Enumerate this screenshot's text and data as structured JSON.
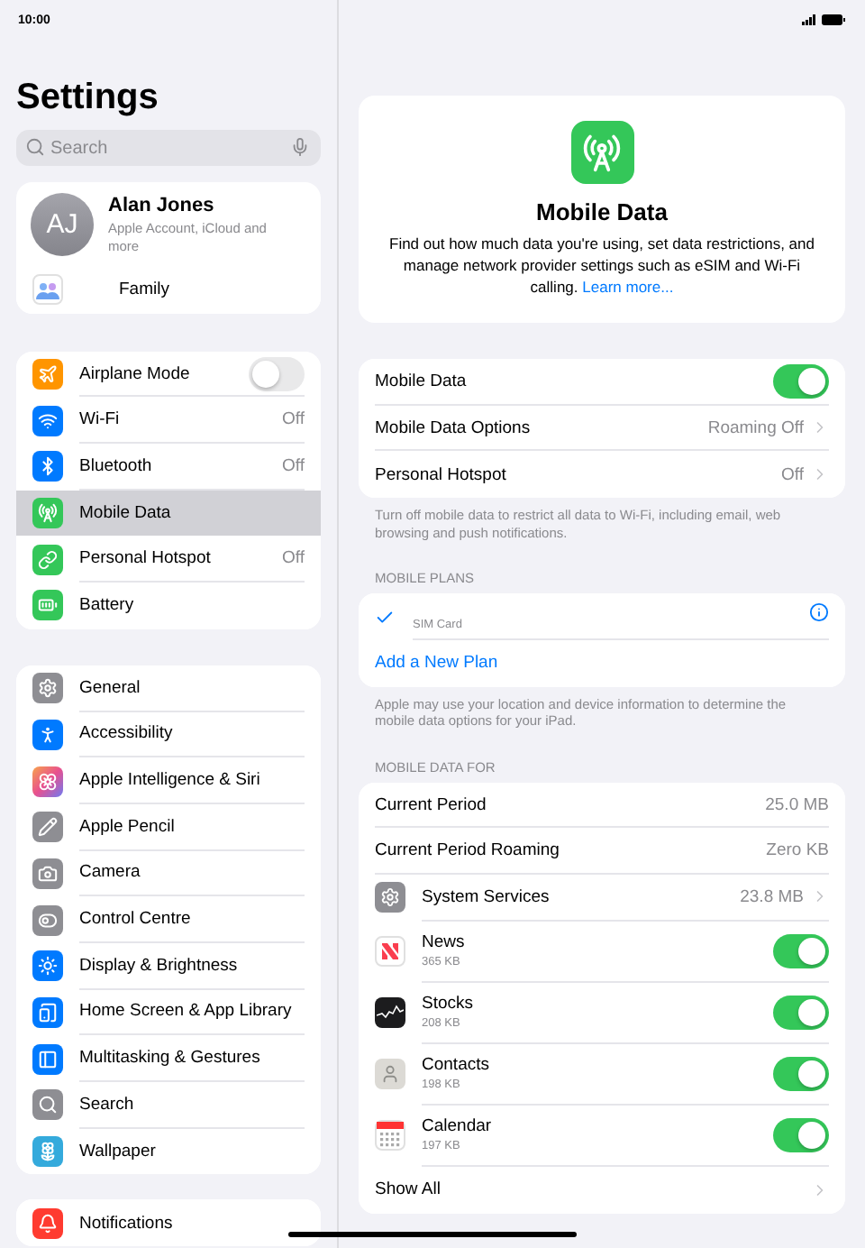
{
  "status_bar": {
    "time": "10:00"
  },
  "sidebar": {
    "title": "Settings",
    "search": {
      "placeholder": "Search"
    },
    "account": {
      "initials": "AJ",
      "name": "Alan Jones",
      "subtitle": "Apple Account, iCloud and more",
      "family": "Family"
    },
    "groups": [
      [
        {
          "label": "Airplane Mode",
          "kind": "toggle",
          "on": false,
          "selected": false
        },
        {
          "label": "Wi-Fi",
          "kind": "value",
          "value": "Off",
          "selected": false
        },
        {
          "label": "Bluetooth",
          "kind": "value",
          "value": "Off",
          "selected": false
        },
        {
          "label": "Mobile Data",
          "kind": "plain",
          "selected": true
        },
        {
          "label": "Personal Hotspot",
          "kind": "value",
          "value": "Off",
          "selected": false
        },
        {
          "label": "Battery",
          "kind": "plain",
          "selected": false
        }
      ],
      [
        {
          "label": "General",
          "kind": "plain",
          "selected": false
        },
        {
          "label": "Accessibility",
          "kind": "plain",
          "selected": false
        },
        {
          "label": "Apple Intelligence & Siri",
          "kind": "plain",
          "selected": false
        },
        {
          "label": "Apple Pencil",
          "kind": "plain",
          "selected": false
        },
        {
          "label": "Camera",
          "kind": "plain",
          "selected": false
        },
        {
          "label": "Control Centre",
          "kind": "plain",
          "selected": false
        },
        {
          "label": "Display & Brightness",
          "kind": "plain",
          "selected": false
        },
        {
          "label": "Home Screen & App Library",
          "kind": "plain",
          "selected": false
        },
        {
          "label": "Multitasking & Gestures",
          "kind": "plain",
          "selected": false
        },
        {
          "label": "Search",
          "kind": "plain",
          "selected": false
        },
        {
          "label": "Wallpaper",
          "kind": "plain",
          "selected": false
        }
      ],
      [
        {
          "label": "Notifications",
          "kind": "plain",
          "selected": false
        }
      ]
    ]
  },
  "detail": {
    "header": {
      "title": "Mobile Data",
      "description": "Find out how much data you're using, set data restrictions, and manage network provider settings such as eSIM and Wi-Fi calling.",
      "link": "Learn more..."
    },
    "settings": [
      {
        "label": "Mobile Data",
        "kind": "toggle",
        "on": true
      },
      {
        "label": "Mobile Data Options",
        "kind": "link",
        "value": "Roaming Off"
      },
      {
        "label": "Personal Hotspot",
        "kind": "link",
        "value": "Off"
      }
    ],
    "settings_note": "Turn off mobile data to restrict all data to Wi-Fi, including email, web browsing and push notifications.",
    "plans_heading": "MOBILE PLANS",
    "plans": {
      "sim": "SIM Card",
      "checked": true,
      "add": "Add a New Plan"
    },
    "plans_note": "Apple may use your location and device information to determine the mobile data options for your iPad.",
    "usage_heading": "MOBILE DATA FOR",
    "usage": [
      {
        "kind": "stat",
        "label": "Current Period",
        "value": "25.0 MB"
      },
      {
        "kind": "stat",
        "label": "Current Period Roaming",
        "value": "Zero KB"
      },
      {
        "kind": "service",
        "label": "System Services",
        "value": "23.8 MB"
      },
      {
        "kind": "app",
        "label": "News",
        "sub": "365 KB",
        "on": true
      },
      {
        "kind": "app",
        "label": "Stocks",
        "sub": "208 KB",
        "on": true
      },
      {
        "kind": "app",
        "label": "Contacts",
        "sub": "198 KB",
        "on": true
      },
      {
        "kind": "app",
        "label": "Calendar",
        "sub": "197 KB",
        "on": true
      },
      {
        "kind": "more",
        "label": "Show All"
      }
    ]
  }
}
